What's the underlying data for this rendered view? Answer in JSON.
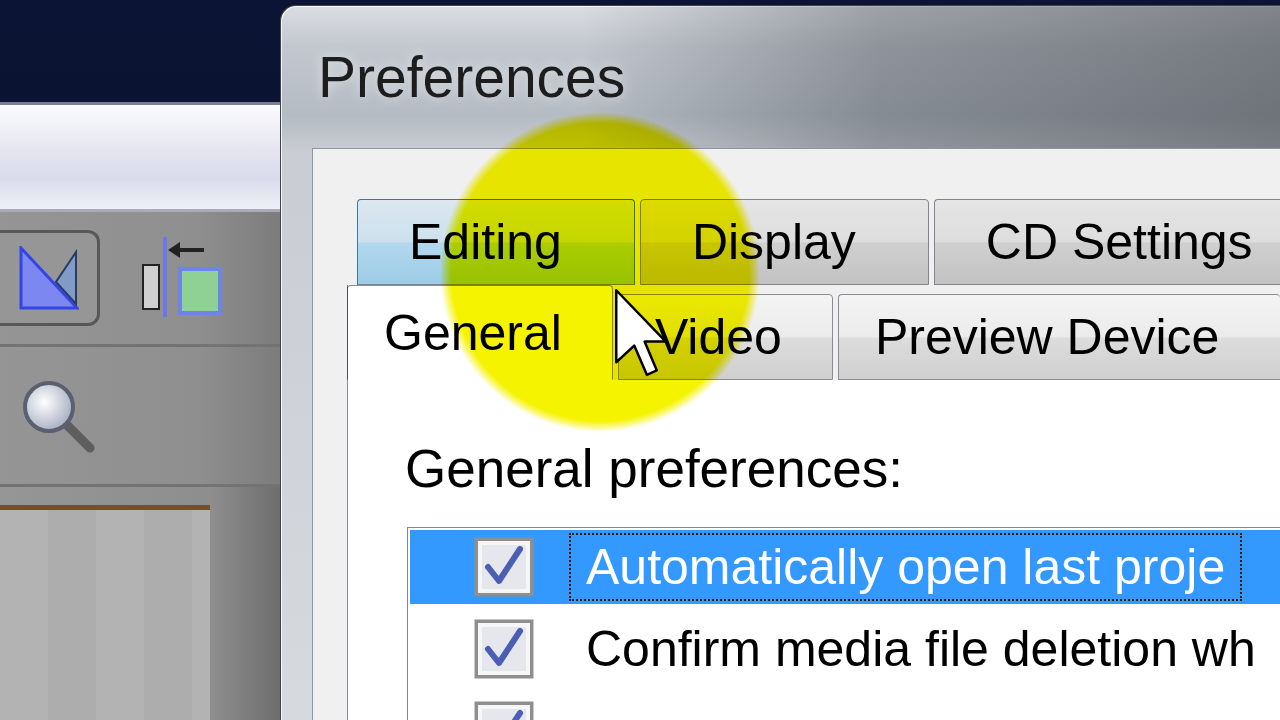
{
  "background_window": {
    "toolbar_buttons": [
      {
        "kind": "triangle",
        "pressed": true
      },
      {
        "kind": "insert",
        "pressed": false
      }
    ]
  },
  "dialog": {
    "title": "Preferences"
  },
  "tab_rows": [
    {
      "tabs": [
        {
          "label": "Editing",
          "selected": false,
          "hovered": true
        },
        {
          "label": "Display",
          "selected": false,
          "hovered": false
        },
        {
          "label": "CD Settings",
          "selected": false,
          "hovered": false
        }
      ]
    },
    {
      "tabs": [
        {
          "label": "General",
          "selected": true,
          "hovered": false
        },
        {
          "label": "Video",
          "selected": false,
          "hovered": false
        },
        {
          "label": "Preview Device",
          "selected": false,
          "hovered": false
        }
      ]
    }
  ],
  "panel": {
    "heading": "General preferences:",
    "items": [
      {
        "label": "Automatically open last proje",
        "checked": true,
        "selected": true
      },
      {
        "label": "Confirm media file deletion wh",
        "checked": true,
        "selected": false
      },
      {
        "checked": true,
        "selected": false
      }
    ]
  }
}
